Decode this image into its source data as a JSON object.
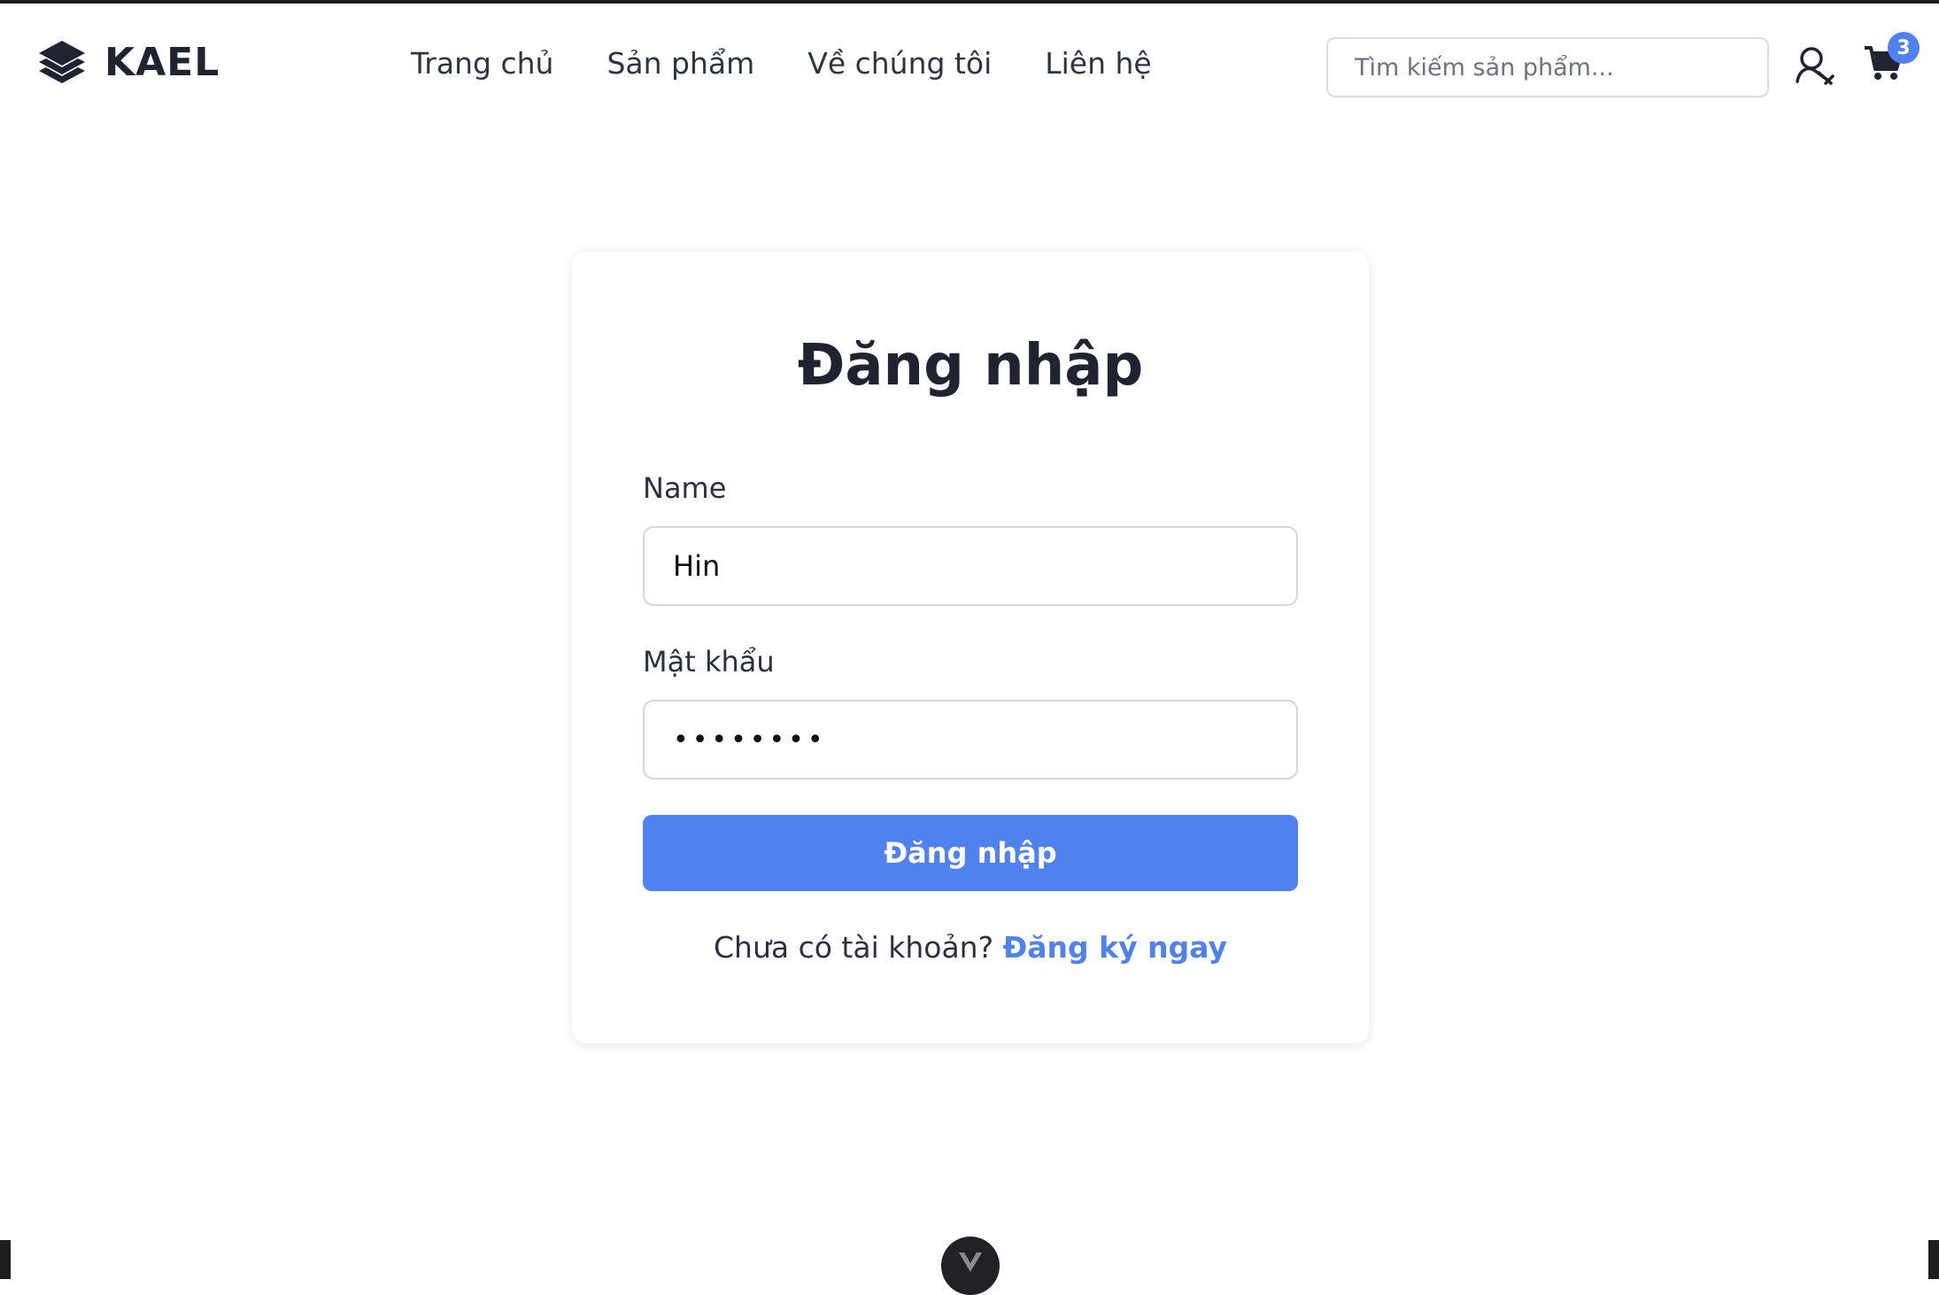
{
  "brand": {
    "name": "KAEL"
  },
  "nav": {
    "items": [
      "Trang chủ",
      "Sản phẩm",
      "Về chúng tôi",
      "Liên hệ"
    ]
  },
  "header": {
    "search_placeholder": "Tìm kiếm sản phẩm...",
    "cart_count": "3"
  },
  "login": {
    "title": "Đăng nhập",
    "name_label": "Name",
    "name_value": "Hin",
    "password_label": "Mật khẩu",
    "password_value": "••••••••",
    "submit_label": "Đăng nhập",
    "no_account_text": "Chưa có tài khoản?",
    "register_link": "Đăng ký ngay"
  },
  "colors": {
    "accent": "#4f82ee",
    "text_dark": "#1f2430"
  },
  "icons": {
    "logo": "layers-icon",
    "user": "user-icon",
    "cart": "cart-icon",
    "devtools": "vue-devtools-icon"
  }
}
